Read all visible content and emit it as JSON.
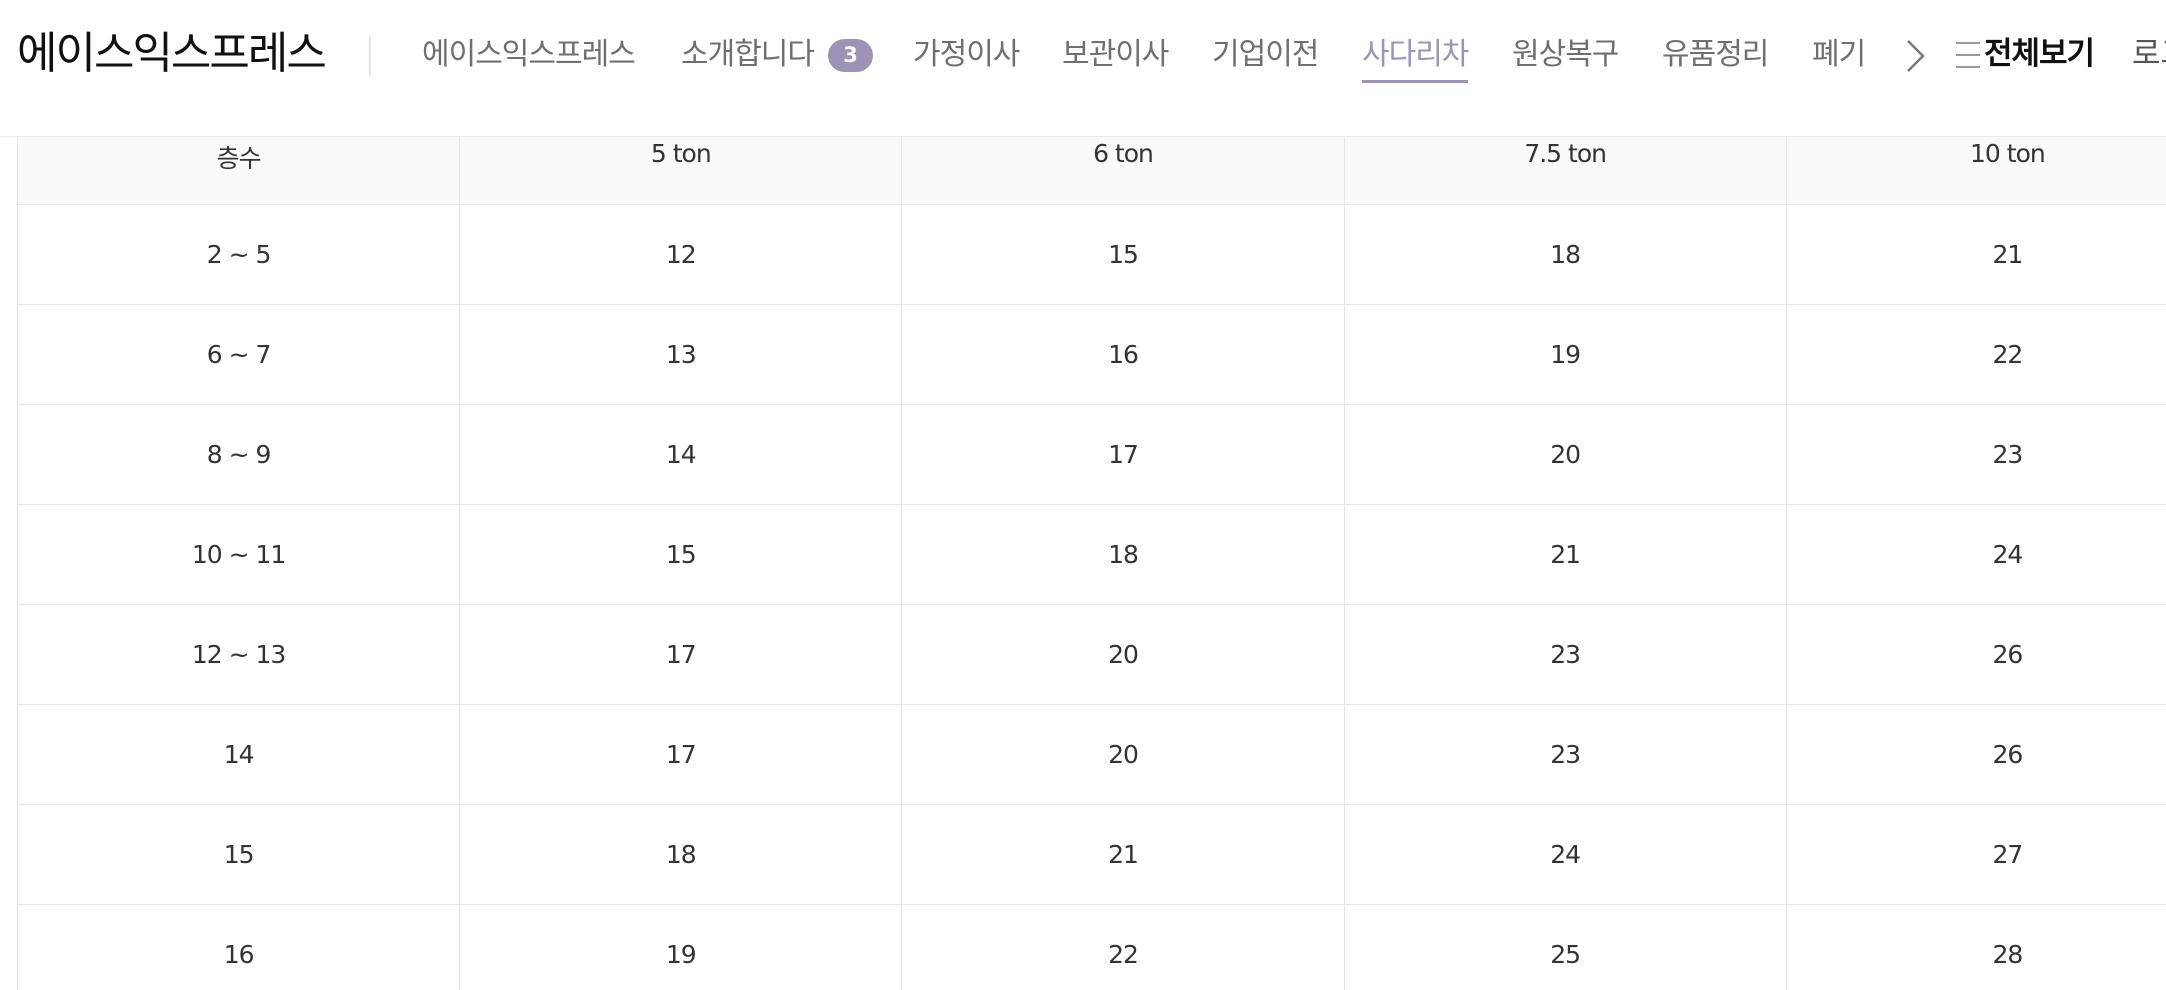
{
  "header": {
    "brand": "에이스익스프레스",
    "nav": [
      {
        "label": "에이스익스프레스"
      },
      {
        "label": "소개합니다"
      },
      {
        "label": "가정이사"
      },
      {
        "label": "보관이사"
      },
      {
        "label": "기업이전"
      },
      {
        "label": "사다리차",
        "active": true
      },
      {
        "label": "원상복구"
      },
      {
        "label": "유품정리"
      },
      {
        "label": "폐기"
      }
    ],
    "badge_count": "3",
    "view_all_label": "전체보기",
    "login_label": "로그인",
    "accent_color": "#9d93b6"
  },
  "icons": {
    "next": "chevron-right-icon",
    "menu": "menu-icon"
  },
  "table": {
    "headers": [
      "층수",
      "5 ton",
      "6 ton",
      "7.5 ton",
      "10 ton"
    ],
    "rows": [
      [
        "2 ~ 5",
        "12",
        "15",
        "18",
        "21"
      ],
      [
        "6 ~ 7",
        "13",
        "16",
        "19",
        "22"
      ],
      [
        "8 ~ 9",
        "14",
        "17",
        "20",
        "23"
      ],
      [
        "10 ~ 11",
        "15",
        "18",
        "21",
        "24"
      ],
      [
        "12 ~ 13",
        "17",
        "20",
        "23",
        "26"
      ],
      [
        "14",
        "17",
        "20",
        "23",
        "26"
      ],
      [
        "15",
        "18",
        "21",
        "24",
        "27"
      ],
      [
        "16",
        "19",
        "22",
        "25",
        "28"
      ]
    ]
  }
}
